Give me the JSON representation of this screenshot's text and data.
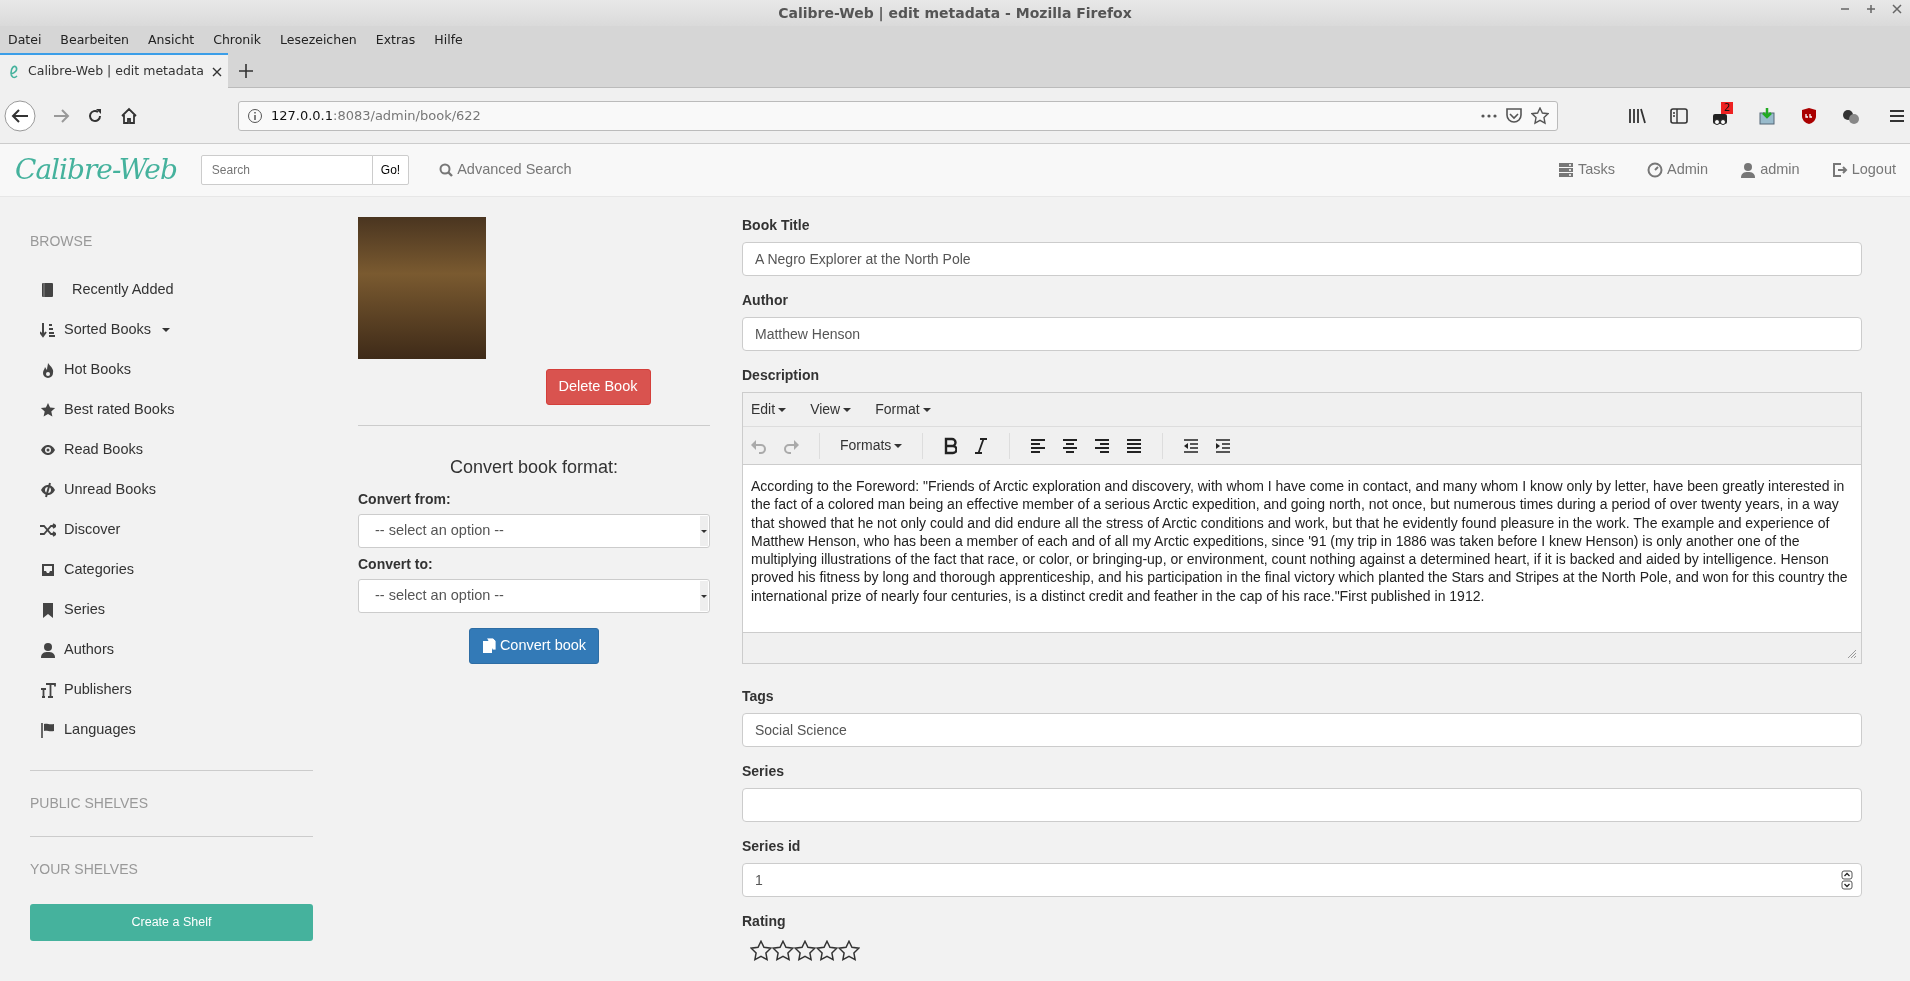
{
  "window": {
    "title": "Calibre-Web | edit metadata - Mozilla Firefox"
  },
  "menu_bar": [
    "Datei",
    "Bearbeiten",
    "Ansicht",
    "Chronik",
    "Lesezeichen",
    "Extras",
    "Hilfe"
  ],
  "tabs": [
    {
      "label": "Calibre-Web | edit metadata",
      "selected": true
    }
  ],
  "address_bar": {
    "host": "127.0.0.1",
    "rest": ":8083/admin/book/622"
  },
  "toolbar": {
    "addon_badge": "2"
  },
  "navbar": {
    "logo": "Calibre-Web",
    "search_placeholder": "Search",
    "go_button": "Go!",
    "advanced_search": "Advanced Search",
    "links": [
      "Tasks",
      "Admin",
      "admin",
      "Logout"
    ]
  },
  "sidebar": {
    "browse_heading": "BROWSE",
    "items": [
      {
        "label": "Recently Added",
        "dropdown": false
      },
      {
        "label": "Sorted Books",
        "dropdown": true
      },
      {
        "label": "Hot Books",
        "dropdown": false
      },
      {
        "label": "Best rated Books",
        "dropdown": false
      },
      {
        "label": "Read Books",
        "dropdown": false
      },
      {
        "label": "Unread Books",
        "dropdown": false
      },
      {
        "label": "Discover",
        "dropdown": false
      },
      {
        "label": "Categories",
        "dropdown": false
      },
      {
        "label": "Series",
        "dropdown": false
      },
      {
        "label": "Authors",
        "dropdown": false
      },
      {
        "label": "Publishers",
        "dropdown": false
      },
      {
        "label": "Languages",
        "dropdown": false
      }
    ],
    "public_shelves": "PUBLIC SHELVES",
    "your_shelves": "YOUR SHELVES",
    "create_shelf": "Create a Shelf"
  },
  "book": {
    "delete_button": "Delete Book",
    "convert_heading": "Convert book format:",
    "convert_from_label": "Convert from:",
    "convert_from": "-- select an option --",
    "convert_to_label": "Convert to:",
    "convert_to": "-- select an option --",
    "convert_button": "Convert book"
  },
  "form": {
    "title_label": "Book Title",
    "title": "A Negro Explorer at the North Pole",
    "author_label": "Author",
    "author": "Matthew Henson",
    "description_label": "Description",
    "editor_menus": [
      "Edit",
      "View",
      "Format"
    ],
    "history_buttons": [
      {
        "disabled": true
      },
      {
        "disabled": true
      }
    ],
    "formats_button": "Formats",
    "description": "According to the Foreword: \"Friends of Arctic exploration and discovery, with whom I have come in contact, and many whom I know only by letter, have been greatly interested in the fact of a colored man being an effective member of a serious Arctic expedition, and going north, not once, but numerous times during a period of over twenty years, in a way that showed that he not only could and did endure all the stress of Arctic conditions and work, but that he evidently found pleasure in the work. The example and experience of Matthew Henson, who has been a member of each and of all my Arctic expeditions, since '91 (my trip in 1886 was taken before I knew Henson) is only another one of the multiplying illustrations of the fact that race, or color, or bringing-up, or environment, count nothing against a determined heart, if it is backed and aided by intelligence. Henson proved his fitness by long and thorough apprenticeship, and his participation in the final victory which planted the Stars and Stripes at the North Pole, and won for this country the international prize of nearly four centuries, is a distinct credit and feather in the cap of his race.\"First published in 1912.",
    "tags_label": "Tags",
    "tags": "Social Science",
    "series_label": "Series",
    "series_id_label": "Series id",
    "series_id": "1",
    "rating_label": "Rating",
    "rating": {
      "stars": 0
    }
  }
}
